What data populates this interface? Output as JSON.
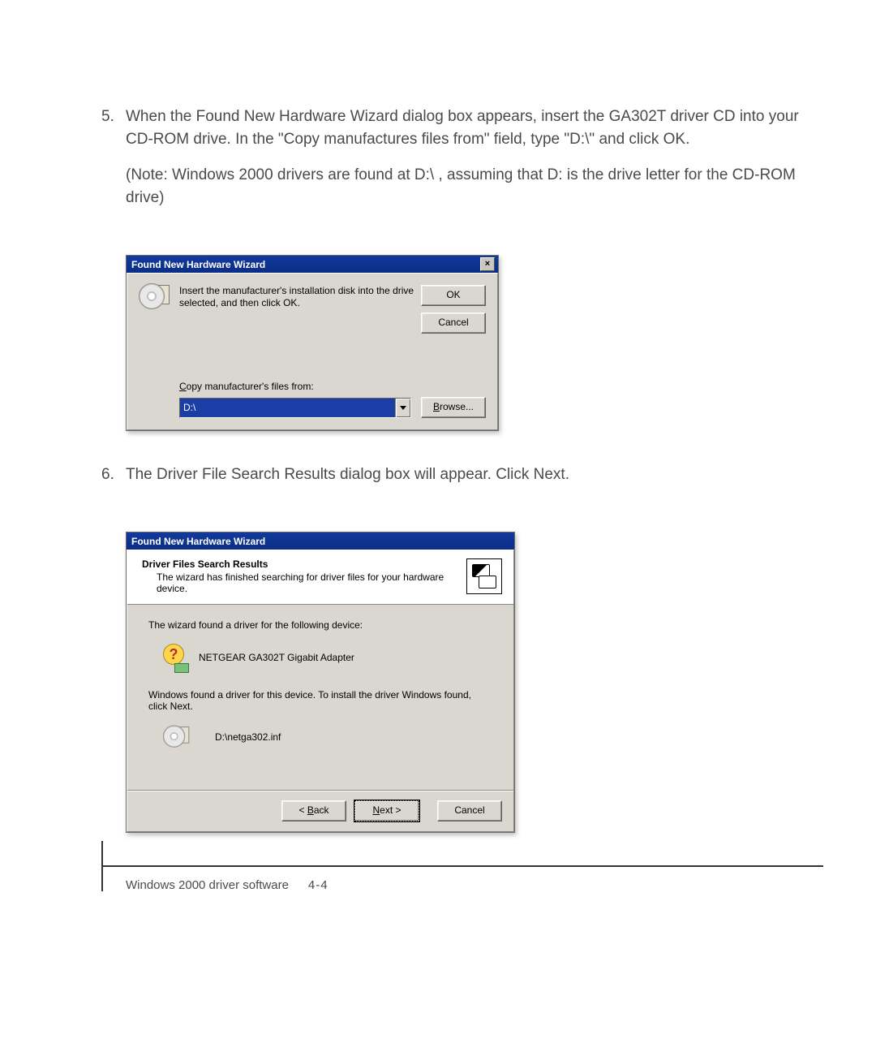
{
  "steps": {
    "s5": {
      "num": "5.",
      "p1": "When the Found New Hardware Wizard dialog box appears, insert the GA302T driver CD into your CD-ROM drive. In the \"Copy manufactures files from\" field, type \"D:\\\" and click OK.",
      "p2": "(Note: Windows 2000 drivers are found at D:\\ , assuming that D: is the drive letter for the CD-ROM drive)"
    },
    "s6": {
      "num": "6.",
      "p1": "The Driver File Search Results dialog box will appear.  Click Next."
    }
  },
  "dlg1": {
    "title": "Found New Hardware Wizard",
    "msg": "Insert the manufacturer's installation disk into the drive selected, and then click OK.",
    "ok": "OK",
    "cancel": "Cancel",
    "label_pre": "C",
    "label_rest": "opy manufacturer's files from:",
    "value": "D:\\",
    "browse_pre": "B",
    "browse_rest": "rowse..."
  },
  "dlg2": {
    "title": "Found New Hardware Wizard",
    "header_title": "Driver Files Search Results",
    "header_sub": "The wizard has finished searching for driver files for your hardware device.",
    "line1": "The wizard found a driver for the following device:",
    "device": "NETGEAR GA302T Gigabit Adapter",
    "line2": "Windows found a driver for this device. To install the driver Windows found, click Next.",
    "inf": "D:\\netga302.inf",
    "back_pre": "< ",
    "back_u": "B",
    "back_rest": "ack",
    "next_u": "N",
    "next_rest": "ext >",
    "cancel": "Cancel"
  },
  "footer": {
    "text": "Windows 2000 driver software",
    "page": "4-4"
  }
}
